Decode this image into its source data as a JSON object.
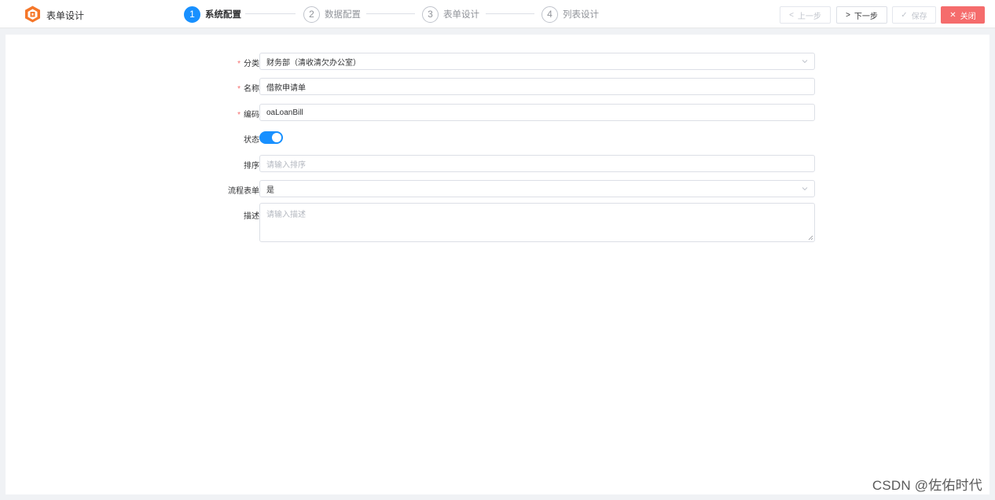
{
  "header": {
    "app_title": "表单设计",
    "steps": [
      {
        "number": "1",
        "label": "系统配置",
        "active": true
      },
      {
        "number": "2",
        "label": "数据配置",
        "active": false
      },
      {
        "number": "3",
        "label": "表单设计",
        "active": false
      },
      {
        "number": "4",
        "label": "列表设计",
        "active": false
      }
    ],
    "buttons": {
      "prev": {
        "label": "上一步",
        "icon": "chevron-left-icon",
        "disabled": true
      },
      "next": {
        "label": "下一步",
        "icon": "chevron-right-icon",
        "disabled": false
      },
      "save": {
        "label": "保存",
        "icon": "check-icon",
        "disabled": true
      },
      "close": {
        "label": "关闭",
        "icon": "close-icon",
        "disabled": false
      }
    },
    "logo_icon": "app-logo-icon"
  },
  "form": {
    "category": {
      "label": "分类",
      "required_mark": "*",
      "value": "财务部（清收清欠办公室）"
    },
    "name": {
      "label": "名称",
      "required_mark": "*",
      "value": "借款申请单"
    },
    "code": {
      "label": "编码",
      "required_mark": "*",
      "value": "oaLoanBill"
    },
    "status": {
      "label": "状态",
      "on": true
    },
    "sort": {
      "label": "排序",
      "placeholder": "请输入排序"
    },
    "flow_form": {
      "label": "流程表单",
      "value": "是"
    },
    "description": {
      "label": "描述",
      "placeholder": "请输入描述"
    }
  },
  "watermark": "CSDN @佐佑时代",
  "colors": {
    "primary": "#1890ff",
    "danger": "#f56c6c",
    "logo": "#f5772a"
  }
}
